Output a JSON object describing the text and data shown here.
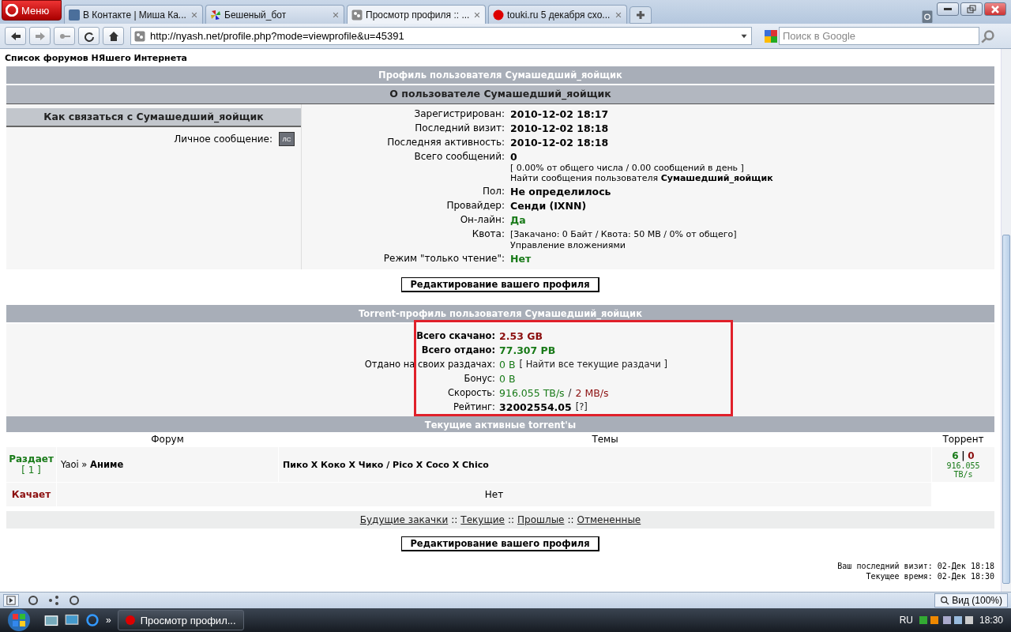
{
  "browser": {
    "menu_label": "Меню",
    "tabs": [
      {
        "title": "В Контакте | Миша Ка...",
        "selected": false
      },
      {
        "title": "Бешеный_бот",
        "selected": false
      },
      {
        "title": "Просмотр профиля :: ...",
        "selected": true
      },
      {
        "title": "touki.ru 5 декабря схо...",
        "selected": false
      }
    ],
    "url": "http://nyash.net/profile.php?mode=viewprofile&u=45391",
    "search": {
      "placeholder": "Поиск в Google"
    }
  },
  "page": {
    "forum_title": "Список форумов НЯшего Интернета",
    "profile_header": "Профиль пользователя Сумашедший_яойщик",
    "about_header": "О пользователе Сумашедший_яойщик",
    "contact": {
      "header": "Как связаться с Сумашедший_яойщик",
      "label": "Личное сообщение:",
      "button": "ЛС"
    },
    "info": [
      {
        "label": "Зарегистрирован:",
        "value": "2010-12-02 18:17",
        "kind": "bold"
      },
      {
        "label": "Последний визит:",
        "value": "2010-12-02 18:18",
        "kind": "bold"
      },
      {
        "label": "Последняя активность:",
        "value": "2010-12-02 18:18",
        "kind": "bold"
      },
      {
        "label": "Всего сообщений:",
        "value": "0",
        "kind": "bold",
        "notes": [
          "[ 0.00% от общего числа / 0.00 сообщений в день ]",
          "Найти сообщения пользователя **Сумашедший_яойщик**"
        ]
      },
      {
        "label": "Пол:",
        "value": "Не определилось",
        "kind": "bold"
      },
      {
        "label": "Провайдер:",
        "value": "Сенди (IXNN)",
        "kind": "bold"
      },
      {
        "label": "Он-лайн:",
        "value": "Да",
        "kind": "green"
      },
      {
        "label": "Квота:",
        "value": "[Закачано: 0 Байт / Квота: 50 MB / 0% от общего]",
        "kind": "small",
        "notes": [
          "Управление вложениями"
        ]
      },
      {
        "label": "Режим \"только чтение\":",
        "value": "Нет",
        "kind": "green"
      }
    ],
    "edit_button": "Редактирование вашего профиля",
    "torrent_header": "Torrent-профиль пользователя Сумашедший_яойщик",
    "stats": [
      {
        "label": "Всего скачано:",
        "strong": true,
        "parts": [
          {
            "text": "2.53 GB",
            "kind": "red"
          }
        ]
      },
      {
        "label": "Всего отдано:",
        "strong": true,
        "parts": [
          {
            "text": "77.307 PB",
            "kind": "green"
          }
        ]
      },
      {
        "label": "Отдано на своих раздачах:",
        "strong": false,
        "parts": [
          {
            "text": "0 B",
            "kind": "green"
          },
          {
            "text": "[ Найти все текущие раздачи ]",
            "kind": "plain"
          }
        ]
      },
      {
        "label": "Бонус:",
        "strong": false,
        "parts": [
          {
            "text": "0 B",
            "kind": "green"
          }
        ]
      },
      {
        "label": "Скорость:",
        "strong": false,
        "parts": [
          {
            "text": "916.055 TB/s",
            "kind": "green"
          },
          {
            "text": "/",
            "kind": "plain"
          },
          {
            "text": "2 MB/s",
            "kind": "red"
          }
        ]
      },
      {
        "label": "Рейтинг:",
        "strong": false,
        "parts": [
          {
            "text": "32002554.05",
            "kind": "bold"
          },
          {
            "text": "[?]",
            "kind": "plain"
          }
        ]
      }
    ],
    "active_header": "Текущие активные torrent'ы",
    "columns": [
      "Форум",
      "Темы",
      "Торрент"
    ],
    "active": [
      {
        "status": "Раздает",
        "count": "[ 1 ]",
        "kind": "seeding",
        "forum": "Yaoi » **Аниме**",
        "topic": "Пико X Коко X Чико / Pico X Coco X Chico",
        "seeds": "6",
        "separator": "|",
        "leeches": "0",
        "speed": "916.055 TB/s"
      },
      {
        "status": "Качает",
        "kind": "leeching",
        "empty": "Нет"
      }
    ],
    "links": [
      {
        "text": "Будущие закачки"
      },
      {
        "text": "Текущие"
      },
      {
        "text": "Прошлые"
      },
      {
        "text": "Отмененные"
      }
    ],
    "link_separator": "::",
    "edit_button_2": "Редактирование вашего профиля",
    "footer": [
      "Ваш последний визит: 02-Дек 18:18",
      "Текущее время: 02-Дек 18:30"
    ]
  },
  "status_bar": {
    "zoom": "Вид (100%)"
  },
  "taskbar": {
    "more": "»",
    "task": "Просмотр профил...",
    "language": "RU",
    "clock": "18:30"
  }
}
